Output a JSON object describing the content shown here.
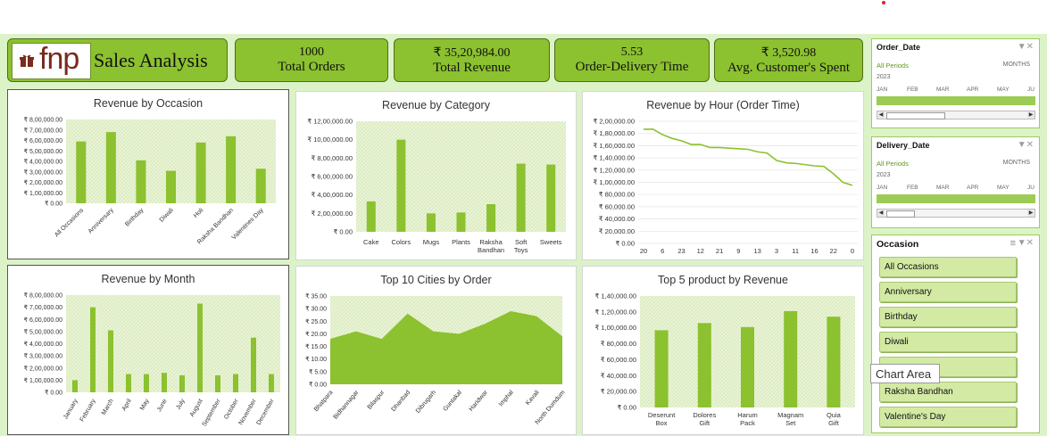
{
  "header": {
    "logo_text": "fnp",
    "title": "Sales Analysis"
  },
  "kpis": [
    {
      "value": "1000",
      "label": "Total Orders"
    },
    {
      "value": "₹ 35,20,984.00",
      "label": "Total Revenue"
    },
    {
      "value": "5.53",
      "label": "Order-Delivery Time"
    },
    {
      "value": "₹ 3,520.98",
      "label": "Avg. Customer's Spent"
    }
  ],
  "colors": {
    "accent": "#8cc12f",
    "bar": "#8cc12f",
    "pattern_bg": "#eaf4d9",
    "border": "#4f6e1a"
  },
  "chart_data": [
    {
      "id": "occasion",
      "type": "bar",
      "title": "Revenue by Occasion",
      "categories": [
        "All Occasions",
        "Anniversary",
        "Birthday",
        "Diwali",
        "Holi",
        "Raksha Bandhan",
        "Valentines Day"
      ],
      "values": [
        590000,
        680000,
        410000,
        310000,
        580000,
        640000,
        330000
      ],
      "ylim": [
        0,
        800000
      ],
      "yticks": [
        "₹ 0.00",
        "₹ 1,00,000.00",
        "₹ 2,00,000.00",
        "₹ 3,00,000.00",
        "₹ 4,00,000.00",
        "₹ 5,00,000.00",
        "₹ 6,00,000.00",
        "₹ 7,00,000.00",
        "₹ 8,00,000.00"
      ]
    },
    {
      "id": "category",
      "type": "bar",
      "title": "Revenue by Category",
      "categories": [
        "Cake",
        "Colors",
        "Mugs",
        "Plants",
        "Raksha Bandhan",
        "Soft Toys",
        "Sweets"
      ],
      "values": [
        330000,
        1000000,
        200000,
        210000,
        300000,
        740000,
        730000
      ],
      "ylim": [
        0,
        1200000
      ],
      "yticks": [
        "₹ 0.00",
        "₹ 2,00,000.00",
        "₹ 4,00,000.00",
        "₹ 6,00,000.00",
        "₹ 8,00,000.00",
        "₹ 10,00,000.00",
        "₹ 12,00,000.00"
      ]
    },
    {
      "id": "hour",
      "type": "line",
      "title": "Revenue by Hour (Order Time)",
      "categories": [
        "20",
        "",
        "6",
        "",
        "23",
        "",
        "12",
        "",
        "21",
        "",
        "9",
        "",
        "13",
        "",
        "3",
        "",
        "11",
        "",
        "16",
        "",
        "22",
        "",
        "0",
        ""
      ],
      "values": [
        187000,
        187000,
        178000,
        172000,
        168000,
        162000,
        162000,
        157000,
        157000,
        156000,
        155000,
        154000,
        150000,
        148000,
        136000,
        132000,
        131000,
        129000,
        127000,
        126000,
        114000,
        100000,
        95000
      ],
      "ylim": [
        0,
        200000
      ],
      "yticks": [
        "₹ 0.00",
        "₹ 20,000.00",
        "₹ 40,000.00",
        "₹ 60,000.00",
        "₹ 80,000.00",
        "₹ 1,00,000.00",
        "₹ 1,20,000.00",
        "₹ 1,40,000.00",
        "₹ 1,60,000.00",
        "₹ 1,80,000.00",
        "₹ 2,00,000.00"
      ]
    },
    {
      "id": "month",
      "type": "bar",
      "title": "Revenue by Month",
      "categories": [
        "January",
        "February",
        "March",
        "April",
        "May",
        "June",
        "July",
        "August",
        "September",
        "October",
        "November",
        "December"
      ],
      "values": [
        100000,
        700000,
        510000,
        150000,
        150000,
        160000,
        140000,
        730000,
        140000,
        150000,
        450000,
        150000
      ],
      "ylim": [
        0,
        800000
      ],
      "yticks": [
        "₹ 0.00",
        "₹ 1,00,000.00",
        "₹ 2,00,000.00",
        "₹ 3,00,000.00",
        "₹ 4,00,000.00",
        "₹ 5,00,000.00",
        "₹ 6,00,000.00",
        "₹ 7,00,000.00",
        "₹ 8,00,000.00"
      ]
    },
    {
      "id": "cities",
      "type": "area",
      "title": "Top 10 Cities by Order",
      "categories": [
        "Bhatpara",
        "Bidhannagar",
        "Bilaspur",
        "Dhanbad",
        "Dibrugarh",
        "Guntakal",
        "Haridwar",
        "Imphal",
        "Kavali",
        "North Dumdum"
      ],
      "values": [
        18,
        21,
        18,
        28,
        21,
        20,
        24,
        29,
        27,
        19
      ],
      "ylim": [
        0,
        35
      ],
      "yticks": [
        "₹ 0.00",
        "₹ 5.00",
        "₹ 10.00",
        "₹ 15.00",
        "₹ 20.00",
        "₹ 25.00",
        "₹ 30.00",
        "₹ 35.00"
      ]
    },
    {
      "id": "products",
      "type": "bar",
      "title": "Top 5 product by Revenue",
      "categories": [
        "Deserunt Box",
        "Dolores Gift",
        "Harum Pack",
        "Magnam Set",
        "Quia Gift"
      ],
      "values": [
        97000,
        106000,
        101000,
        121000,
        114000
      ],
      "ylim": [
        0,
        140000
      ],
      "yticks": [
        "₹ 0.00",
        "₹ 20,000.00",
        "₹ 40,000.00",
        "₹ 60,000.00",
        "₹ 80,000.00",
        "₹ 1,00,000.00",
        "₹ 1,20,000.00",
        "₹ 1,40,000.00"
      ]
    }
  ],
  "slicers": {
    "order_date": {
      "title": "Order_Date",
      "periods": "All Periods",
      "level": "MONTHS",
      "year": "2023",
      "months": [
        "JAN",
        "FEB",
        "MAR",
        "APR",
        "MAY",
        "JU"
      ]
    },
    "delivery_date": {
      "title": "Delivery_Date",
      "periods": "All Periods",
      "level": "MONTHS",
      "year": "2023",
      "months": [
        "JAN",
        "FEB",
        "MAR",
        "APR",
        "MAY",
        "JU"
      ]
    },
    "occasion": {
      "title": "Occasion",
      "items": [
        "All Occasions",
        "Anniversary",
        "Birthday",
        "Diwali",
        "",
        "Raksha Bandhan",
        "Valentine's Day"
      ]
    }
  },
  "tooltip": "Chart Area",
  "icons": {
    "filter": "filter-clear-icon",
    "multiselect": "multi-select-icon",
    "gift": "gift-icon"
  }
}
